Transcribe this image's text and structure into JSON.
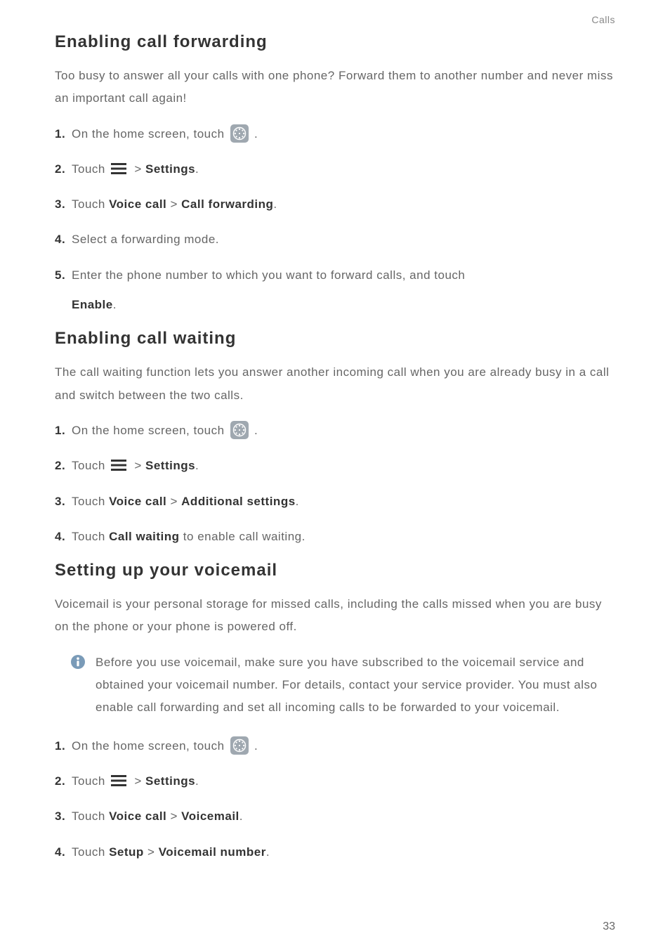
{
  "header": {
    "chapter": "Calls"
  },
  "sections": {
    "call_forwarding": {
      "title": "Enabling  call  forwarding",
      "intro": "Too busy to answer all your calls with one phone? Forward them to another number and never miss an important call again!",
      "steps": {
        "s1_pre": "On the home screen, touch ",
        "s1_post": ".",
        "s2_pre": "Touch ",
        "s2_gt": " > ",
        "s2_settings": "Settings",
        "s2_post": ".",
        "s3_pre": "Touch ",
        "s3_a": "Voice call",
        "s3_gt": " > ",
        "s3_b": "Call forwarding",
        "s3_post": ".",
        "s4": "Select a forwarding mode.",
        "s5_pre": "Enter the phone number to which you want to forward calls, and touch",
        "s5_enable": "Enable",
        "s5_post": "."
      }
    },
    "call_waiting": {
      "title": "Enabling  call  waiting",
      "intro": "The call waiting function lets you answer another incoming call when you are already busy in a call and switch between the two calls.",
      "steps": {
        "s1_pre": "On the home screen, touch ",
        "s1_post": ".",
        "s2_pre": "Touch ",
        "s2_gt": " > ",
        "s2_settings": "Settings",
        "s2_post": ".",
        "s3_pre": "Touch ",
        "s3_a": "Voice call",
        "s3_gt": " > ",
        "s3_b": "Additional settings",
        "s3_post": ".",
        "s4_pre": "Touch ",
        "s4_bold": "Call waiting",
        "s4_post": " to enable call waiting."
      }
    },
    "voicemail": {
      "title": "Setting  up  your  voicemail",
      "intro": "Voicemail is your personal storage for missed calls, including the calls missed when you are busy on the phone or your phone is powered off.",
      "note": "Before you use voicemail, make sure you have subscribed to the voicemail service and obtained your voicemail number. For details, contact your service provider. You must also enable call forwarding and set all incoming calls to be forwarded to your voicemail.",
      "steps": {
        "s1_pre": "On the home screen, touch ",
        "s1_post": ".",
        "s2_pre": "Touch ",
        "s2_gt": " > ",
        "s2_settings": "Settings",
        "s2_post": ".",
        "s3_pre": "Touch ",
        "s3_a": "Voice call",
        "s3_gt": " > ",
        "s3_b": "Voicemail",
        "s3_post": ".",
        "s4_pre": "Touch ",
        "s4_a": "Setup",
        "s4_gt": " > ",
        "s4_b": "Voicemail number",
        "s4_post": "."
      }
    }
  },
  "page_number": "33",
  "icons": {
    "dialer": "dialer-icon",
    "menu": "menu-icon",
    "info": "info-icon"
  }
}
